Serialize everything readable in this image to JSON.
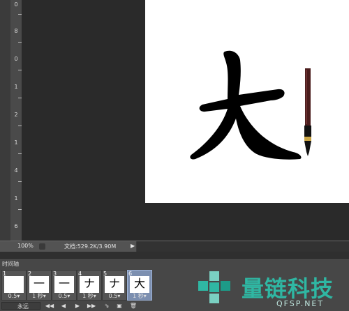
{
  "ruler": {
    "labels": [
      "0",
      "8",
      "0",
      "1",
      "2",
      "1",
      "4",
      "1",
      "6"
    ]
  },
  "status": {
    "zoom": "100%",
    "doc_info": "文档:529.2K/3.90M"
  },
  "timeline": {
    "panel_title": "时间轴",
    "frames": [
      {
        "number": "1",
        "delay": "0.5▾",
        "glyph": ""
      },
      {
        "number": "2",
        "delay": "1 秒▾",
        "glyph": "一"
      },
      {
        "number": "3",
        "delay": "0.5▾",
        "glyph": "一"
      },
      {
        "number": "4",
        "delay": "1 秒▾",
        "glyph": "ナ"
      },
      {
        "number": "5",
        "delay": "0.5▾",
        "glyph": "ナ"
      },
      {
        "number": "6",
        "delay": "1 秒▾",
        "glyph": "大"
      }
    ],
    "loop_label": "永远",
    "controls": [
      "◀◀",
      "◀",
      "▶",
      "▶▶",
      "⇘",
      "▣",
      "🗑"
    ]
  },
  "colors": {
    "canvas": "#ffffff",
    "panel": "#474747",
    "selected_frame": "#7c8fb0",
    "watermark": "#2fb7a3"
  },
  "watermark": {
    "title": "量链科技",
    "url": "QFSP.NET"
  },
  "icons": [
    "zoom-icon",
    "menu-arrow-icon",
    "brush-icon",
    "play-icon",
    "watermark-logo-icon"
  ]
}
